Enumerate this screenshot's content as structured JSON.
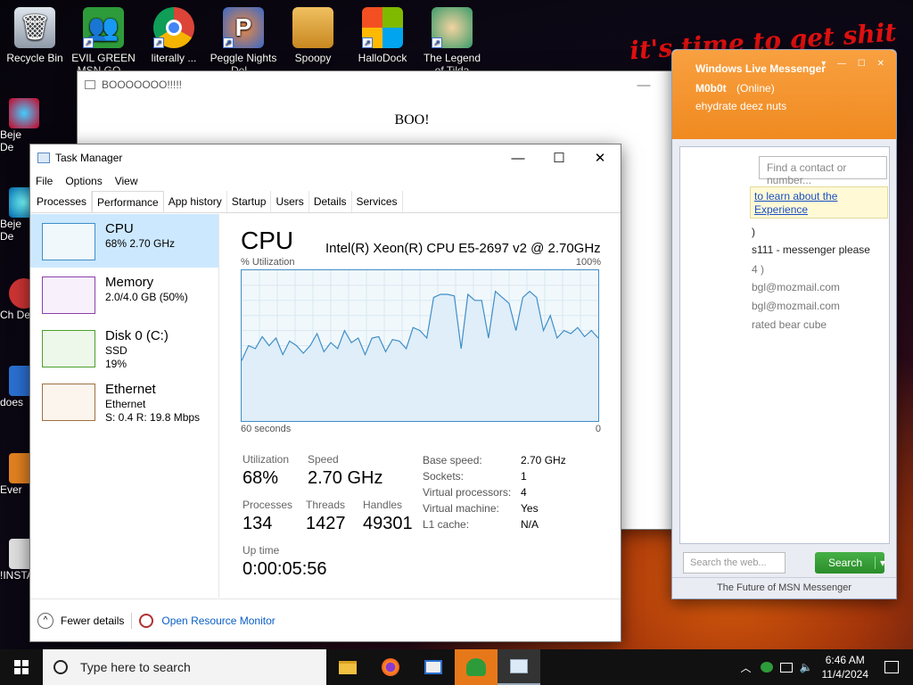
{
  "desktop": {
    "icons": [
      {
        "label": "Recycle Bin",
        "icon": "recycle-bin-icon",
        "color": "#9aa7b5"
      },
      {
        "label": "EVIL GREEN MSN GO...",
        "icon": "msn-buddy-icon",
        "color": "#2e9b3a"
      },
      {
        "label": "literally ...",
        "icon": "chrome-icon",
        "color": "#db4437"
      },
      {
        "label": "Peggle Nights Del...",
        "icon": "peggle-icon",
        "color": "#e0602a"
      },
      {
        "label": "Spoopy",
        "icon": "folder-icon",
        "color": "#e0a233"
      },
      {
        "label": "HalloDock",
        "icon": "windows-logo-icon",
        "color": "#2f8ae0"
      },
      {
        "label": "The Legend of Tilda",
        "icon": "game-character-icon",
        "color": "#3a9b6a"
      }
    ],
    "side_labels": [
      "Beje De",
      "Beje De",
      "Ch De",
      "does",
      "Ever",
      "!INSTA"
    ],
    "graffiti": "it's time to get shit"
  },
  "boo_window": {
    "title": "BOOOOOOO!!!!!",
    "body": "BOO!"
  },
  "msn": {
    "title": "Windows Live Messenger",
    "username": "M0b0t",
    "status": "(Online)",
    "psm": "ehydrate deez nuts",
    "find_placeholder": "Find a contact or number...",
    "banner": "to learn about the Experience",
    "contacts": [
      ")",
      "s111 - messenger please",
      "4 )",
      "bgl@mozmail.com",
      "bgl@mozmail.com",
      "rated bear cube"
    ],
    "search_placeholder": "Search the web...",
    "search_button": "Search",
    "footer": "The Future of MSN Messenger"
  },
  "task_manager": {
    "title": "Task Manager",
    "menu": [
      "File",
      "Options",
      "View"
    ],
    "tabs": [
      "Processes",
      "Performance",
      "App history",
      "Startup",
      "Users",
      "Details",
      "Services"
    ],
    "active_tab": "Performance",
    "sidebar": [
      {
        "name": "CPU",
        "sub1": "68% 2.70 GHz",
        "sub2": "",
        "color": "#3f8ec8"
      },
      {
        "name": "Memory",
        "sub1": "2.0/4.0 GB (50%)",
        "sub2": "",
        "color": "#8b3fa8"
      },
      {
        "name": "Disk 0 (C:)",
        "sub1": "SSD",
        "sub2": "19%",
        "color": "#4aa02c"
      },
      {
        "name": "Ethernet",
        "sub1": "Ethernet",
        "sub2": "S: 0.4 R: 19.8 Mbps",
        "color": "#a07040"
      }
    ],
    "cpu": {
      "heading": "CPU",
      "model": "Intel(R) Xeon(R) CPU E5-2697 v2 @ 2.70GHz",
      "util_label": "% Utilization",
      "util_max": "100%",
      "x_left": "60 seconds",
      "x_right": "0",
      "utilization_series": [
        40,
        50,
        48,
        56,
        50,
        55,
        44,
        53,
        50,
        45,
        50,
        58,
        46,
        52,
        48,
        60,
        52,
        55,
        44,
        55,
        56,
        46,
        54,
        53,
        48,
        62,
        60,
        55,
        82,
        84,
        84,
        83,
        48,
        84,
        80,
        80,
        55,
        86,
        82,
        78,
        60,
        82,
        86,
        82,
        60,
        70,
        55,
        60,
        58,
        62,
        56,
        60,
        55
      ],
      "stats": {
        "utilization_label": "Utilization",
        "utilization": "68%",
        "speed_label": "Speed",
        "speed": "2.70 GHz",
        "processes_label": "Processes",
        "processes": "134",
        "threads_label": "Threads",
        "threads": "1427",
        "handles_label": "Handles",
        "handles": "49301",
        "uptime_label": "Up time",
        "uptime": "0:00:05:56"
      },
      "specs": [
        {
          "k": "Base speed:",
          "v": "2.70 GHz"
        },
        {
          "k": "Sockets:",
          "v": "1"
        },
        {
          "k": "Virtual processors:",
          "v": "4"
        },
        {
          "k": "Virtual machine:",
          "v": "Yes"
        },
        {
          "k": "L1 cache:",
          "v": "N/A"
        }
      ]
    },
    "fewer_details": "Fewer details",
    "open_resource_monitor": "Open Resource Monitor"
  },
  "taskbar": {
    "search_placeholder": "Type here to search",
    "time": "6:46 AM",
    "date": "11/4/2024",
    "accent": "#e7781a"
  }
}
